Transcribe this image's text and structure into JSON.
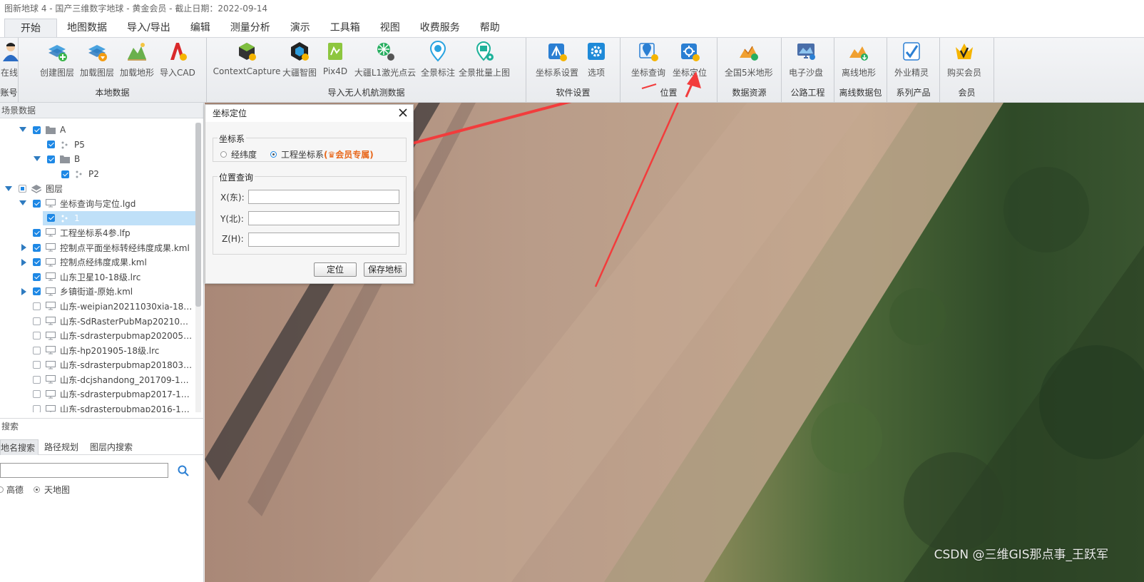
{
  "window": {
    "title": "图新地球 4 - 国产三维数字地球 - 黄金会员 - 截止日期：2022-09-14"
  },
  "menu": {
    "tabs": [
      "开始",
      "地图数据",
      "导入/导出",
      "编辑",
      "测量分析",
      "演示",
      "工具箱",
      "视图",
      "收费服务",
      "帮助"
    ],
    "active": "开始"
  },
  "ribbon": {
    "groups": [
      {
        "label": "账号",
        "items": [
          "在线"
        ]
      },
      {
        "label": "本地数据",
        "items": [
          "创建图层",
          "加载图层",
          "加载地形",
          "导入CAD"
        ]
      },
      {
        "label": "导入无人机航测数据",
        "items": [
          "ContextCapture",
          "大疆智图",
          "Pix4D",
          "大疆L1激光点云",
          "全景标注",
          "全景批量上图"
        ]
      },
      {
        "label": "软件设置",
        "items": [
          "坐标系设置",
          "选项"
        ]
      },
      {
        "label": "位置",
        "items": [
          "坐标查询",
          "坐标定位"
        ]
      },
      {
        "label": "数据资源",
        "items": [
          "全国5米地形"
        ]
      },
      {
        "label": "公路工程",
        "items": [
          "电子沙盘"
        ]
      },
      {
        "label": "离线数据包",
        "items": [
          "离线地形"
        ]
      },
      {
        "label": "系列产品",
        "items": [
          "外业精灵"
        ]
      },
      {
        "label": "会员",
        "items": [
          "购买会员"
        ]
      }
    ]
  },
  "scene_panel": {
    "title": "场景数据",
    "tree": [
      {
        "label": "A"
      },
      {
        "label": "P5"
      },
      {
        "label": "B"
      },
      {
        "label": "P2"
      },
      {
        "label": "图层"
      },
      {
        "label": "坐标查询与定位.lgd"
      },
      {
        "label": "1"
      },
      {
        "label": "工程坐标系4参.lfp"
      },
      {
        "label": "控制点平面坐标转经纬度成果.kml"
      },
      {
        "label": "控制点经纬度成果.kml"
      },
      {
        "label": "山东卫星10-18级.lrc"
      },
      {
        "label": "乡镇街道-原始.kml"
      },
      {
        "label": "山东-weipian20211030xia-18级..."
      },
      {
        "label": "山东-SdRasterPubMap202104..."
      },
      {
        "label": "山东-sdrasterpubmap202005-..."
      },
      {
        "label": "山东-hp201905-18级.lrc"
      },
      {
        "label": "山东-sdrasterpubmap201803-..."
      },
      {
        "label": "山东-dcjshandong_201709-11-..."
      },
      {
        "label": "山东-sdrasterpubmap2017-18..."
      },
      {
        "label": "山东-sdrasterpubmap2016-18..."
      }
    ]
  },
  "search_panel": {
    "title": "搜索",
    "tabs": [
      "地名搜索",
      "路径规划",
      "图层内搜索"
    ],
    "input_value": "",
    "sources": [
      "高德",
      "天地图"
    ],
    "selected_source": "天地图"
  },
  "dialog": {
    "title": "坐标定位",
    "crs_legend": "坐标系",
    "crs_options": [
      "经纬度",
      "工程坐标系"
    ],
    "crs_vip_note": "(♛会员专属)",
    "crs_selected": "工程坐标系",
    "query_legend": "位置查询",
    "fields": [
      {
        "label": "X(东):",
        "value": ""
      },
      {
        "label": "Y(北):",
        "value": ""
      },
      {
        "label": "Z(H):",
        "value": ""
      }
    ],
    "locate_button": "定位",
    "save_button": "保存地标"
  },
  "watermark": "CSDN @三维GIS那点事_王跃军",
  "colors": {
    "accent": "#1e88e5",
    "vip": "#e8681c",
    "arrow": "#f23c3c"
  }
}
